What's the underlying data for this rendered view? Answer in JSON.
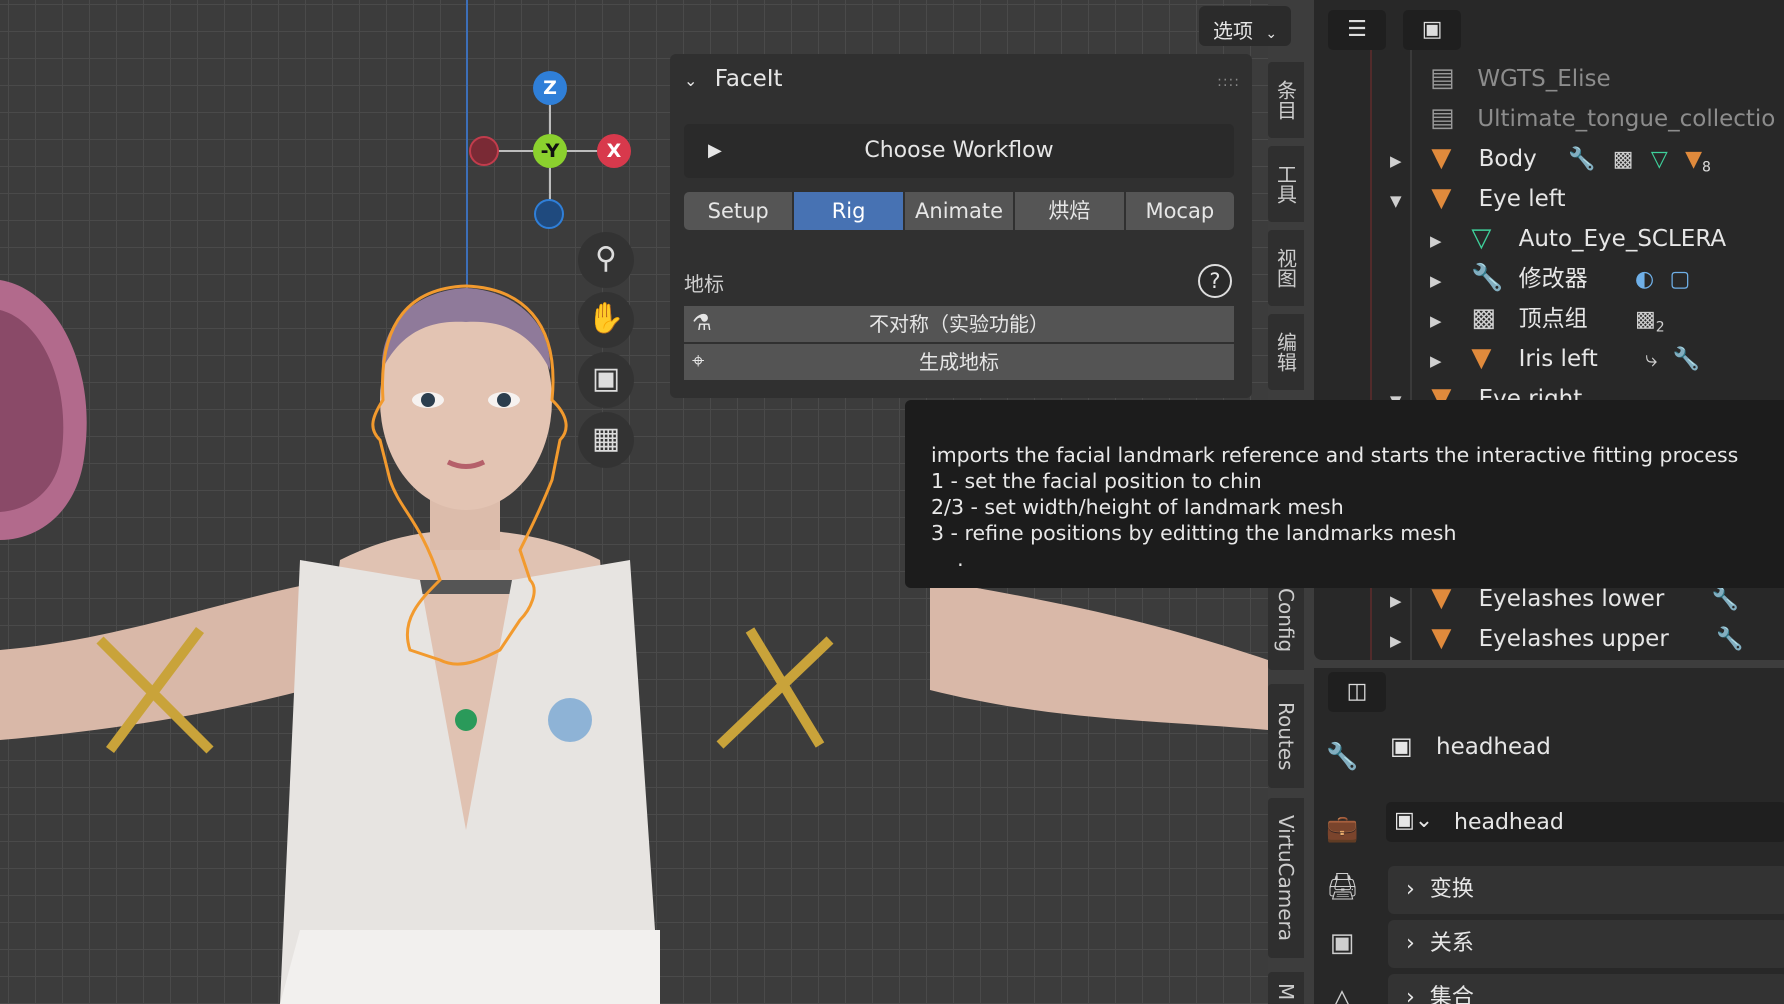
{
  "viewport": {
    "options_label": "选项"
  },
  "gizmo": {
    "z_label": "Z",
    "y_label": "-Y",
    "x_label": "X"
  },
  "panel": {
    "title": "FaceIt",
    "workflow_label": "Choose Workflow",
    "tabs": [
      {
        "label": "Setup",
        "active": false
      },
      {
        "label": "Rig",
        "active": true
      },
      {
        "label": "Animate",
        "active": false
      },
      {
        "label": "烘焙",
        "active": false
      },
      {
        "label": "Mocap",
        "active": false
      }
    ],
    "section_label": "地标",
    "asymmetry_label": "不对称（实验功能）",
    "generate_label": "生成地标"
  },
  "side_tabs": [
    "条目",
    "工具",
    "视图",
    "编辑",
    "Config",
    "Routes",
    "VirtuCamera",
    "M"
  ],
  "tooltip": {
    "lines": [
      "imports the facial landmark reference and starts the interactive fitting process",
      "1 - set the facial position to chin",
      "2/3 - set width/height of landmark mesh",
      "3 - refine positions by editting the landmarks mesh",
      "    ."
    ]
  },
  "outliner": {
    "items": [
      {
        "label": "WGTS_Elise",
        "icon": "collection-icon"
      },
      {
        "label": "Ultimate_tongue_collectio",
        "icon": "collection-icon"
      },
      {
        "label": "Body",
        "icon": "mesh-object-icon",
        "badge": "8"
      },
      {
        "label": "Eye left",
        "icon": "mesh-object-icon"
      },
      {
        "label": "Auto_Eye_SCLERA",
        "icon": "mesh-data-icon"
      },
      {
        "label": "修改器",
        "icon": "wrench-icon"
      },
      {
        "label": "顶点组",
        "icon": "vertex-group-icon",
        "badge": "2"
      },
      {
        "label": "Iris left",
        "icon": "mesh-object-icon"
      },
      {
        "label": "Eye right",
        "icon": "mesh-object-icon"
      },
      {
        "label": "Eyelashes lower",
        "icon": "mesh-object-icon"
      },
      {
        "label": "Eyelashes upper",
        "icon": "mesh-object-icon"
      }
    ]
  },
  "properties": {
    "object_name": "headhead",
    "object_field": "headhead",
    "sections": [
      "变换",
      "关系",
      "集合"
    ]
  }
}
